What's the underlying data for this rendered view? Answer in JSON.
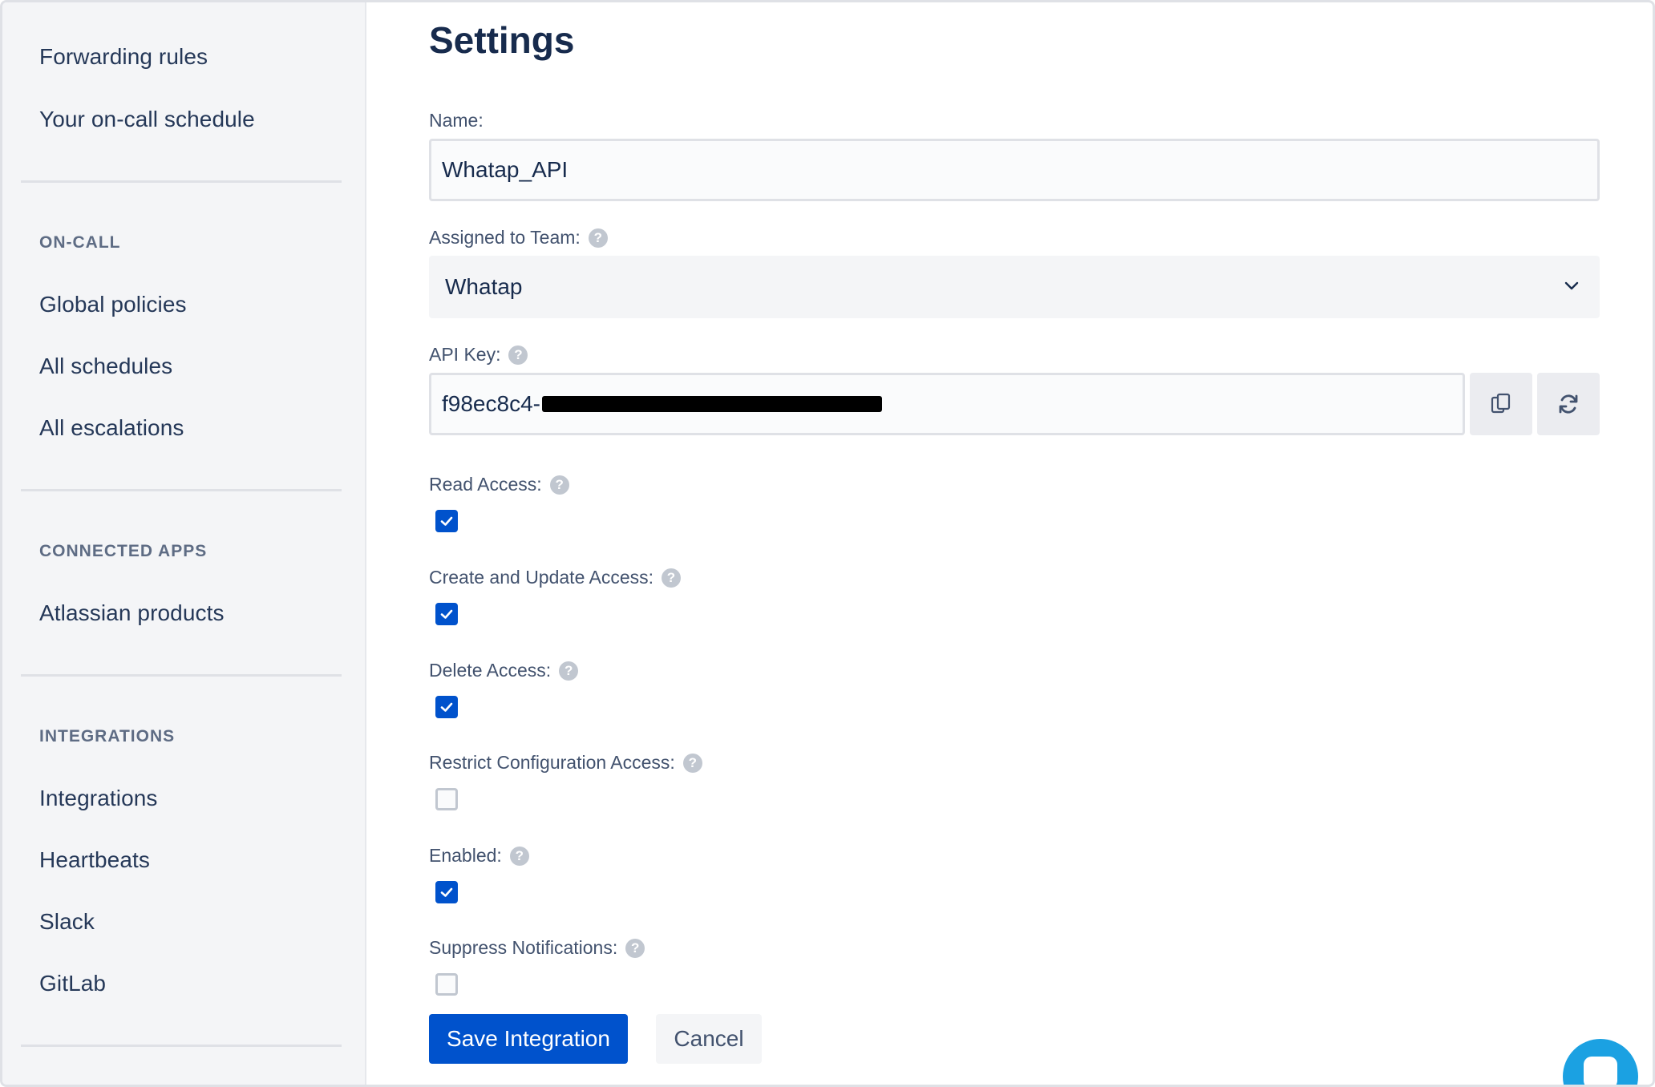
{
  "sidebar": {
    "top_items": [
      {
        "label": "Forwarding rules"
      },
      {
        "label": "Your on-call schedule"
      }
    ],
    "sections": [
      {
        "title": "ON-CALL",
        "items": [
          {
            "label": "Global policies"
          },
          {
            "label": "All schedules"
          },
          {
            "label": "All escalations"
          }
        ]
      },
      {
        "title": "CONNECTED APPS",
        "items": [
          {
            "label": "Atlassian products"
          }
        ]
      },
      {
        "title": "INTEGRATIONS",
        "items": [
          {
            "label": "Integrations"
          },
          {
            "label": "Heartbeats"
          },
          {
            "label": "Slack"
          },
          {
            "label": "GitLab"
          }
        ]
      }
    ]
  },
  "main": {
    "title": "Settings",
    "name_field": {
      "label": "Name:",
      "value": "Whatap_API"
    },
    "team_field": {
      "label": "Assigned to Team:",
      "value": "Whatap"
    },
    "api_key": {
      "label": "API Key:",
      "visible_prefix": "f98ec8c4-",
      "redacted": true
    },
    "access": [
      {
        "label": "Read Access:",
        "checked": true
      },
      {
        "label": "Create and Update Access:",
        "checked": true
      },
      {
        "label": "Delete Access:",
        "checked": true
      },
      {
        "label": "Restrict Configuration Access:",
        "checked": false
      },
      {
        "label": "Enabled:",
        "checked": true
      },
      {
        "label": "Suppress Notifications:",
        "checked": false
      }
    ],
    "buttons": {
      "save": "Save Integration",
      "cancel": "Cancel"
    }
  },
  "icons": {
    "help": "question-circle-icon",
    "chevron": "chevron-down-icon",
    "copy": "copy-icon",
    "regenerate": "refresh-icon",
    "check": "checkmark-icon",
    "chat": "chat-icon"
  },
  "colors": {
    "primary": "#0052cc",
    "sidebar_bg": "#f4f5f7",
    "text": "#172b4d",
    "muted": "#5e6c84",
    "chat": "#1ba1e2"
  }
}
